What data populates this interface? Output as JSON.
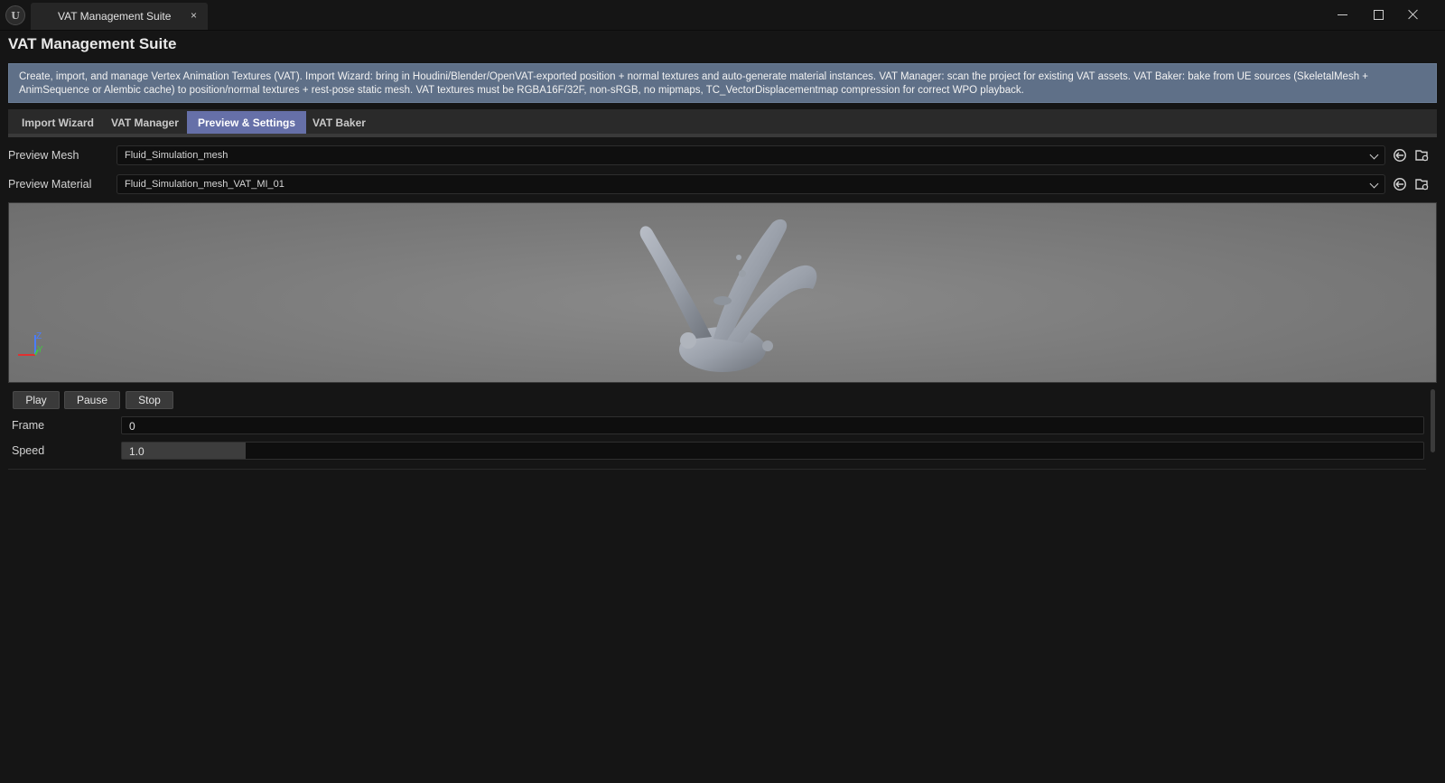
{
  "window": {
    "tab_title": "VAT Management Suite",
    "tab_close": "×"
  },
  "page": {
    "title": "VAT Management Suite",
    "info_text": "Create, import, and manage Vertex Animation Textures (VAT). Import Wizard: bring in Houdini/Blender/OpenVAT-exported position + normal textures and auto-generate material instances. VAT Manager: scan the project for existing VAT assets. VAT Baker: bake from UE sources (SkeletalMesh + AnimSequence or Alembic cache) to position/normal textures + rest-pose static mesh. VAT textures must be RGBA16F/32F, non-sRGB, no mipmaps, TC_VectorDisplacementmap compression for correct WPO playback."
  },
  "tabs": [
    {
      "label": "Import Wizard",
      "active": false
    },
    {
      "label": "VAT Manager",
      "active": false
    },
    {
      "label": "Preview & Settings",
      "active": true
    },
    {
      "label": "VAT Baker",
      "active": false
    }
  ],
  "preview": {
    "mesh_label": "Preview Mesh",
    "mesh_value": "Fluid_Simulation_mesh",
    "material_label": "Preview Material",
    "material_value": "Fluid_Simulation_mesh_VAT_MI_01"
  },
  "viewport": {
    "axis_z": "Z",
    "axis_y": "Y"
  },
  "playback": {
    "play_label": "Play",
    "pause_label": "Pause",
    "stop_label": "Stop",
    "frame_label": "Frame",
    "frame_value": "0",
    "speed_label": "Speed",
    "speed_value": "1.0",
    "speed_fraction": 0.095
  },
  "colors": {
    "accent_tab": "#6670a8",
    "info_bar": "#5f7088",
    "background": "#151515"
  },
  "icons": [
    "ue-logo-icon",
    "minimize-icon",
    "maximize-icon",
    "close-icon",
    "chevron-down-icon",
    "use-selected-icon",
    "browse-icon",
    "axis-gizmo-icon"
  ]
}
